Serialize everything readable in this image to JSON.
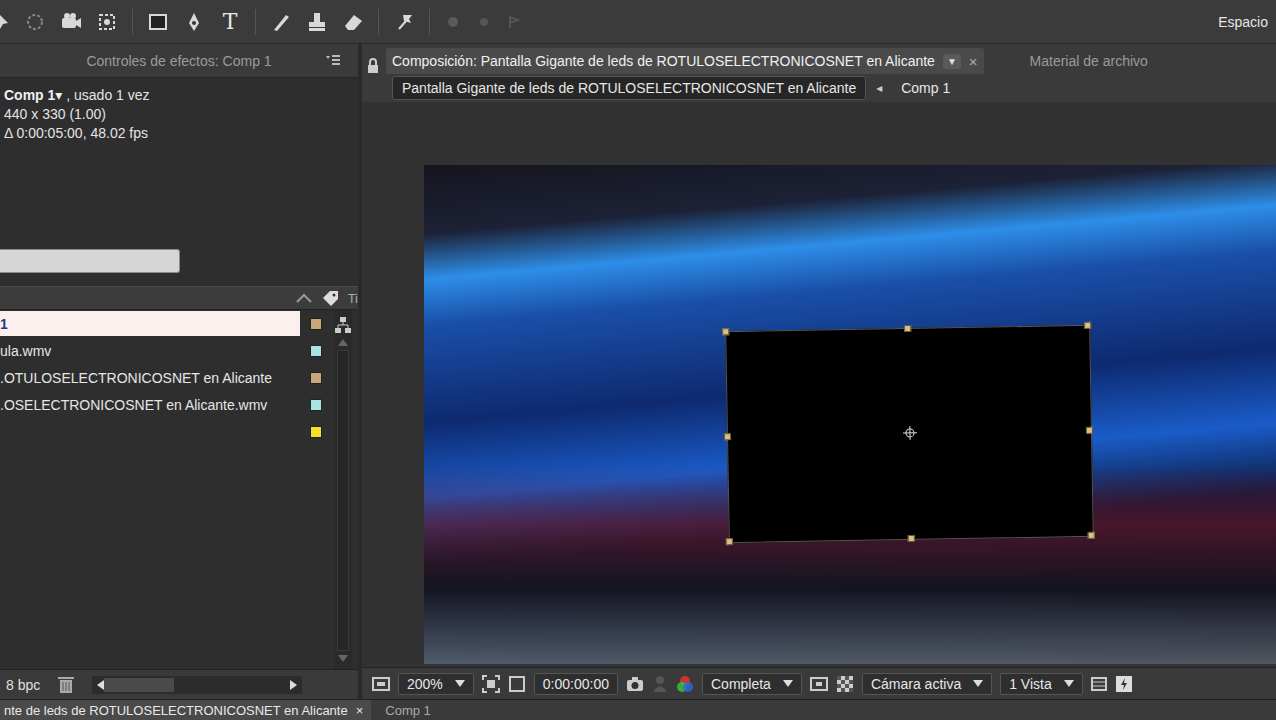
{
  "toolbar": {
    "text_tool": "T",
    "workspace": "Espacio"
  },
  "effects_panel": {
    "tab": "Controles de efectos: Comp 1"
  },
  "project": {
    "name": "Comp 1▾",
    "usage": " , usado 1 vez",
    "size": "440 x 330 (1.00)",
    "duration": "Δ 0:00:05:00, 48.02 fps"
  },
  "project_columns": {
    "type": "Ti"
  },
  "items": [
    {
      "name": "1",
      "selected": true,
      "color": "#c8a878"
    },
    {
      "name": "ula.wmv",
      "selected": false,
      "color": "#a8e4e4"
    },
    {
      "name": ".OTULOSELECTRONICOSNET en Alicante",
      "selected": false,
      "color": "#c8a878"
    },
    {
      "name": ".OSELECTRONICOSNET en Alicante.wmv",
      "selected": false,
      "color": "#a8e4e4"
    },
    {
      "name": "",
      "selected": false,
      "color": "#f2e030"
    }
  ],
  "bit_depth": "8 bpc",
  "composition": {
    "tab": "Composición: Pantalla Gigante de leds de ROTULOSELECTRONICOSNET en Alicante",
    "tab_menu": "▼",
    "tab_close": "×",
    "other_tab": "Material de archivo",
    "breadcrumb_arrow": "◂",
    "breadcrumbs": [
      {
        "label": "Pantalla Gigante de leds de ROTULOSELECTRONICOSNET en Alicante",
        "selected": true
      },
      {
        "label": "Comp 1",
        "selected": false
      }
    ]
  },
  "viewer_bar": {
    "zoom": "200%",
    "timecode": "0:00:00:00",
    "resolution": "Completa",
    "camera": "Cámara activa",
    "views": "1 Vista"
  },
  "bottom_tabs": [
    {
      "label": "nte de leds de ROTULOSELECTRONICOSNET en Alicante",
      "close": "×",
      "selected": true
    },
    {
      "label": "Comp 1",
      "close": "",
      "selected": false
    }
  ]
}
